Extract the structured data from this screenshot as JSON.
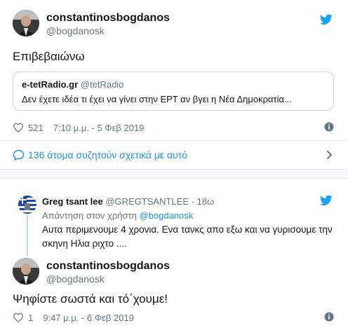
{
  "main_tweet": {
    "author_name": "constantinosbogdanos",
    "author_handle": "@bogdanosk",
    "text": "Επιβεβαιώνω",
    "quote": {
      "name": "e-tetRadio.gr",
      "handle": "@tetRadio",
      "text": "Δεν έχετε ιδέα τι έχει να γίνει στην ΕΡΤ αν βγει η Νέα Δημοκρατία..."
    },
    "likes": "521",
    "timestamp": "7:10 μ.μ. - 5 Φεβ 2019",
    "conversation_label": "136 άτομα συζητούν σχετικά με αυτό"
  },
  "reply": {
    "author_name": "Greg tsant lee",
    "author_handle": "@GREGTSANTLEE",
    "separator": "·",
    "time": "18ω",
    "replying_to_label": "Απάντηση στον χρήστη",
    "replying_to_handle": "@bogdanosk",
    "text": "Αυτα περιμενουμε 4 χρονια. Ενα τανκς απο εξω και να γυρισουμε την σκηνη Ηλια ριχτο ...."
  },
  "second_tweet": {
    "author_name": "constantinosbogdanos",
    "author_handle": "@bogdanosk",
    "text": "Ψηφίστε σωστά και τό΄χουμε!",
    "likes": "1",
    "timestamp": "9:47 μ.μ. - 6 Φεβ 2019"
  },
  "icons": [
    "twitter-bird-icon",
    "heart-icon",
    "info-icon",
    "chat-bubble-icon",
    "chevron-right-icon"
  ],
  "colors": {
    "twitter_blue": "#1da1f2",
    "link_blue": "#1b95e0",
    "text": "#14171a",
    "muted": "#657786",
    "border": "#e1e8ed"
  }
}
